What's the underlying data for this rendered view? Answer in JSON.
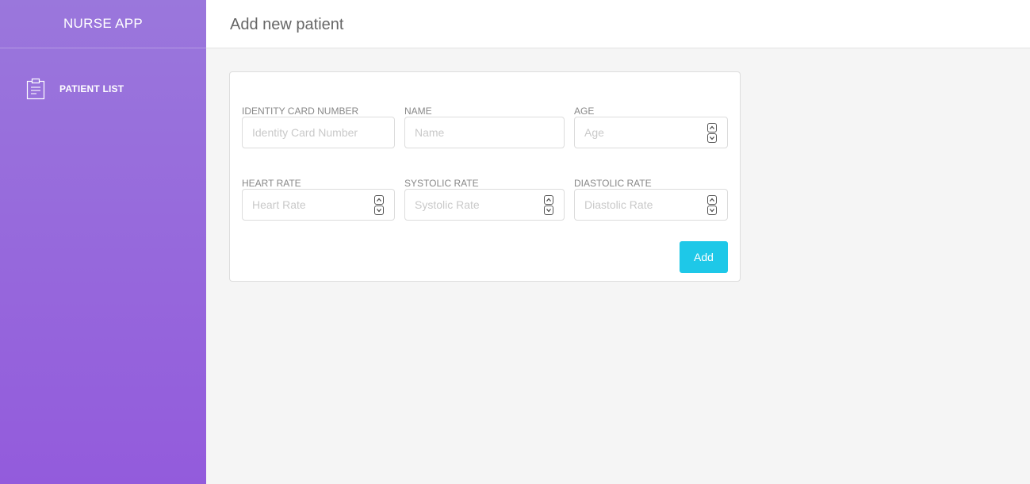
{
  "app": {
    "title": "NURSE APP"
  },
  "sidebar": {
    "items": [
      {
        "label": "PATIENT LIST",
        "icon": "clipboard-icon"
      }
    ]
  },
  "header": {
    "title": "Add new patient"
  },
  "form": {
    "fields": {
      "identity": {
        "label": "IDENTITY CARD NUMBER",
        "placeholder": "Identity Card Number",
        "value": ""
      },
      "name": {
        "label": "NAME",
        "placeholder": "Name",
        "value": ""
      },
      "age": {
        "label": "AGE",
        "placeholder": "Age",
        "value": ""
      },
      "heart_rate": {
        "label": "HEART RATE",
        "placeholder": "Heart Rate",
        "value": ""
      },
      "systolic_rate": {
        "label": "SYSTOLIC RATE",
        "placeholder": "Systolic Rate",
        "value": ""
      },
      "diastolic_rate": {
        "label": "DIASTOLIC RATE",
        "placeholder": "Diastolic Rate",
        "value": ""
      }
    },
    "submit_label": "Add"
  },
  "colors": {
    "sidebar_top": "#9a77dc",
    "sidebar_bottom": "#935bdc",
    "accent_button": "#1ec8e8",
    "background": "#f5f5f5"
  }
}
